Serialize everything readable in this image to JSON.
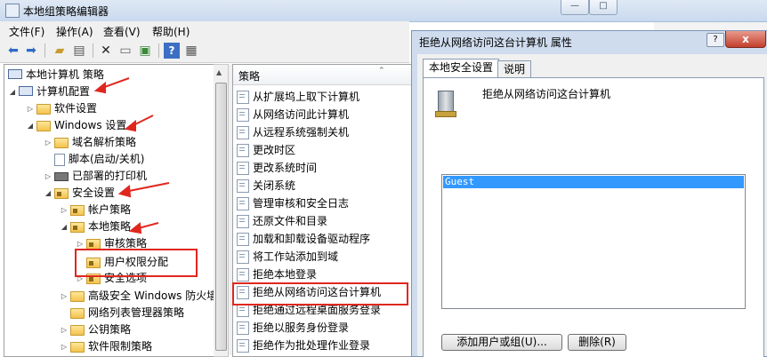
{
  "main_window": {
    "title": "本地组策略编辑器"
  },
  "menu": [
    "文件(F)",
    "操作(A)",
    "查看(V)",
    "帮助(H)"
  ],
  "toolbar_icons": [
    "back-arrow-icon",
    "forward-arrow-icon",
    "up-folder-icon",
    "show-hide-tree-icon",
    "delete-icon",
    "properties-icon",
    "export-icon",
    "help-icon",
    "view-icon"
  ],
  "tree": {
    "root": "本地计算机 策略",
    "computer_config": "计算机配置",
    "software_settings": "软件设置",
    "windows_settings": "Windows 设置",
    "dns_policy": "域名解析策略",
    "scripts": "脚本(启动/关机)",
    "printers": "已部署的打印机",
    "security_settings": "安全设置",
    "account_policy": "帐户策略",
    "local_policy": "本地策略",
    "audit_policy": "审核策略",
    "user_rights": "用户权限分配",
    "security_options": "安全选项",
    "firewall": "高级安全 Windows 防火墙",
    "network_list": "网络列表管理器策略",
    "public_key": "公钥策略",
    "software_restriction": "软件限制策略"
  },
  "list": {
    "header": "策略",
    "items": [
      "从扩展坞上取下计算机",
      "从网络访问此计算机",
      "从远程系统强制关机",
      "更改时区",
      "更改系统时间",
      "关闭系统",
      "管理审核和安全日志",
      "还原文件和目录",
      "加载和卸载设备驱动程序",
      "将工作站添加到域",
      "拒绝本地登录",
      "拒绝从网络访问这台计算机",
      "拒绝通过远程桌面服务登录",
      "拒绝以服务身份登录",
      "拒绝作为批处理作业登录"
    ]
  },
  "dialog": {
    "title": "拒绝从网络访问这台计算机 属性",
    "help_glyph": "?",
    "close_glyph": "x",
    "tabs": [
      "本地安全设置",
      "说明"
    ],
    "policy_name": "拒绝从网络访问这台计算机",
    "users": [
      "Guest"
    ],
    "add_button": "添加用户或组(U)...",
    "remove_button": "删除(R)"
  }
}
